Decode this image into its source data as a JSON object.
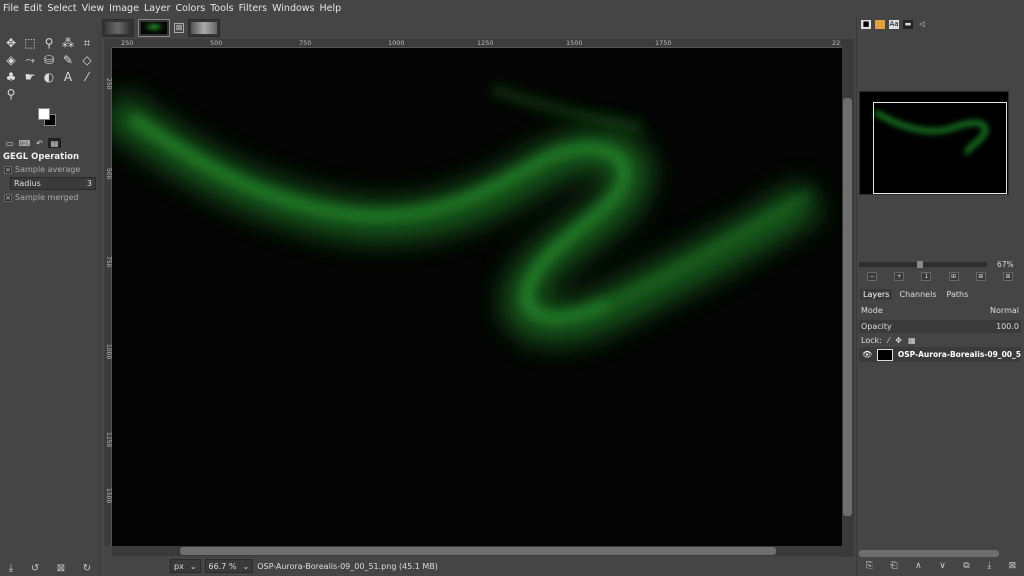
{
  "menu": [
    "File",
    "Edit",
    "Select",
    "View",
    "Image",
    "Layer",
    "Colors",
    "Tools",
    "Filters",
    "Windows",
    "Help"
  ],
  "tab_close_glyph": "⊠",
  "tools": [
    {
      "icon": "move-icon",
      "glyph": "✥"
    },
    {
      "icon": "rect-select-icon",
      "glyph": "⬚"
    },
    {
      "icon": "lasso-icon",
      "glyph": "⚲"
    },
    {
      "icon": "fuzzy-select-icon",
      "glyph": "⁂"
    },
    {
      "icon": "crop-icon",
      "glyph": "⌗"
    },
    {
      "icon": "transform-icon",
      "glyph": "◈"
    },
    {
      "icon": "warp-icon",
      "glyph": "⤳"
    },
    {
      "icon": "bucket-fill-icon",
      "glyph": "⛁"
    },
    {
      "icon": "paintbrush-icon",
      "glyph": "✎"
    },
    {
      "icon": "eraser-icon",
      "glyph": "◇"
    },
    {
      "icon": "clone-icon",
      "glyph": "♣"
    },
    {
      "icon": "smudge-icon",
      "glyph": "☛"
    },
    {
      "icon": "dodge-icon",
      "glyph": "◐"
    },
    {
      "icon": "text-icon",
      "glyph": "A"
    },
    {
      "icon": "color-picker-icon",
      "glyph": "⁄"
    },
    {
      "icon": "zoom-icon",
      "glyph": "⚲"
    }
  ],
  "tool_options": {
    "title": "GEGL Operation",
    "sample_average": "Sample average",
    "radius_label": "Radius",
    "radius_value": "3",
    "sample_merged": "Sample merged",
    "check_glyph": "×"
  },
  "toolbox_bottom": [
    "⤓",
    "↺",
    "⊠",
    "↻"
  ],
  "ruler_top": [
    "250",
    "500",
    "750",
    "1000",
    "1250",
    "1500",
    "1750",
    "22"
  ],
  "ruler_left": [
    "250",
    "500",
    "750",
    "1000",
    "1250",
    "1500",
    "1750"
  ],
  "status": {
    "unit": "px",
    "zoom": "66.7 %",
    "filename": "OSP-Aurora-Borealis-09_00_51.png (45.1 MB)"
  },
  "navigator": {
    "zoom": "67%"
  },
  "layers_panel": {
    "tabs": [
      "Layers",
      "Channels",
      "Paths"
    ],
    "mode_label": "Mode",
    "mode_value": "Normal",
    "opacity_label": "Opacity",
    "opacity_value": "100.0",
    "lock_label": "Lock:",
    "layer_name": "OSP-Aurora-Borealis-09_00_5",
    "eye_glyph": "👁"
  },
  "layers_bottom": [
    "⎘",
    "⎗",
    "∧",
    "∨",
    "⧉",
    "⤓",
    "⊠"
  ],
  "colors": {
    "aurora": "#1f8a2a",
    "canvas": "#030403"
  }
}
